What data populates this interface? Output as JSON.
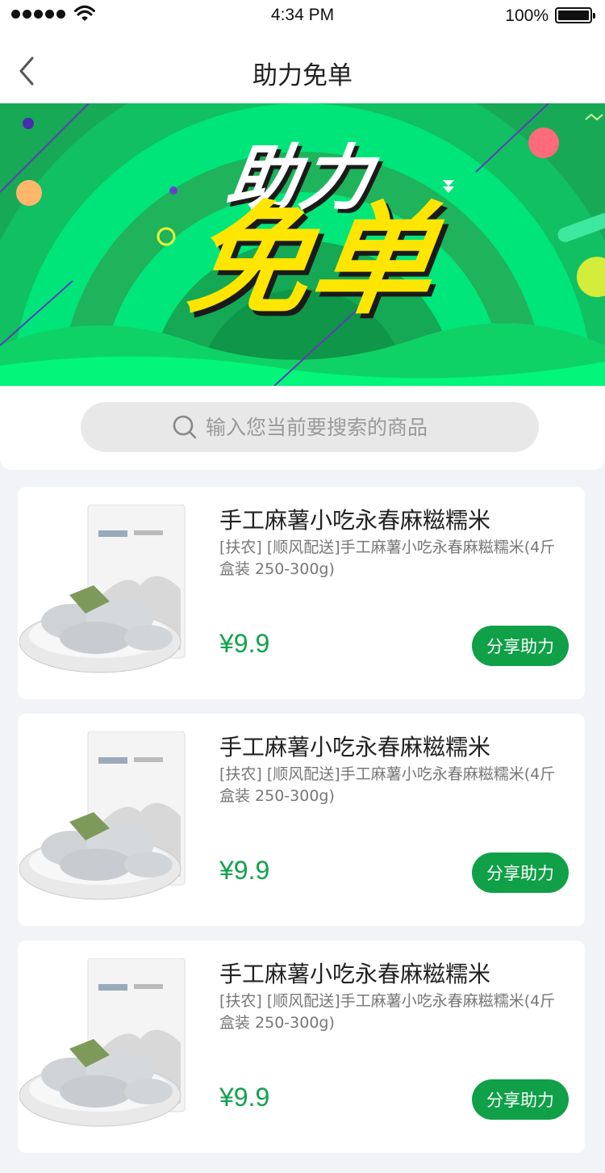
{
  "status_bar": {
    "time": "4:34 PM",
    "battery_percent": "100%",
    "icons": [
      "signal-dots-icon",
      "wifi-icon",
      "battery-icon"
    ]
  },
  "nav": {
    "title": "助力免单",
    "back_icon": "chevron-left-icon"
  },
  "banner": {
    "line1": "助力",
    "line2": "免单",
    "colors": {
      "base": "#1fb35b",
      "accent": "#00e676",
      "headline_yellow": "#ffe600"
    }
  },
  "search": {
    "placeholder": "输入您当前要搜索的商品",
    "icon": "search-icon"
  },
  "products": [
    {
      "title": "手工麻薯小吃永春麻糍糯米",
      "desc": "[扶农] [顺风配送]手工麻薯小吃永春麻糍糯米(4斤盒装 250-300g)",
      "price": "¥9.9",
      "button": "分享助力"
    },
    {
      "title": "手工麻薯小吃永春麻糍糯米",
      "desc": "[扶农] [顺风配送]手工麻薯小吃永春麻糍糯米(4斤盒装 250-300g)",
      "price": "¥9.9",
      "button": "分享助力"
    },
    {
      "title": "手工麻薯小吃永春麻糍糯米",
      "desc": "[扶农] [顺风配送]手工麻薯小吃永春麻糍糯米(4斤盒装 250-300g)",
      "price": "¥9.9",
      "button": "分享助力"
    }
  ],
  "theme": {
    "accent": "#10a048",
    "price_color": "#11a24b",
    "background": "#f2f3f7"
  }
}
